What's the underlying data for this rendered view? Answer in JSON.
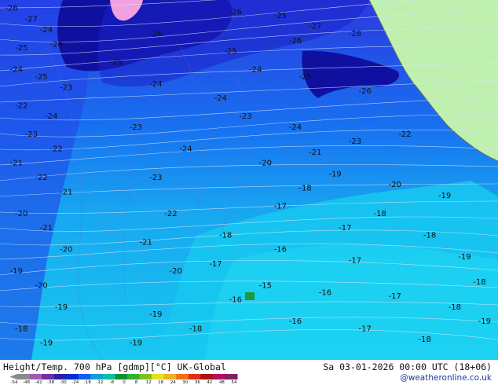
{
  "footer": {
    "title": "Height/Temp. 700 hPa [gdmp][°C] UK-Global",
    "datetime": "Sa 03-01-2026 00:00 UTC (18+06)",
    "credit": "@weatheronline.co.uk"
  },
  "legend": {
    "ticks": [
      "-54",
      "-48",
      "-42",
      "-38",
      "-30",
      "-24",
      "-18",
      "-12",
      "-8",
      "0",
      "8",
      "12",
      "18",
      "24",
      "30",
      "36",
      "42",
      "48",
      "54"
    ],
    "colors": [
      "#8a8a8a",
      "#a05ab4",
      "#7030a0",
      "#3020a0",
      "#0030d0",
      "#1060f0",
      "#10a0d8",
      "#10c0a0",
      "#109030",
      "#30b030",
      "#80c020",
      "#e0e020",
      "#f0b020",
      "#f07010",
      "#e03010",
      "#b01010",
      "#b01060",
      "#802060"
    ]
  },
  "map": {
    "land_color": "#bff0b0",
    "colors": {
      "ice_pink": "#f0a0e0",
      "deep_blue": "#1010a0",
      "mid_blue": "#2a3ae0",
      "bright_blue": "#1870f0",
      "cyan_blue": "#18a8f0",
      "cyan": "#18d0f0"
    },
    "contour_labels": [
      {
        "t": "-26",
        "xf": 0.01,
        "yf": 0.03
      },
      {
        "t": "-27",
        "xf": 0.05,
        "yf": 0.06
      },
      {
        "t": "-24",
        "xf": 0.08,
        "yf": 0.09
      },
      {
        "t": "-25",
        "xf": 0.03,
        "yf": 0.14
      },
      {
        "t": "-26",
        "xf": 0.1,
        "yf": 0.13
      },
      {
        "t": "-24",
        "xf": 0.02,
        "yf": 0.2
      },
      {
        "t": "-25",
        "xf": 0.07,
        "yf": 0.22
      },
      {
        "t": "-23",
        "xf": 0.12,
        "yf": 0.25
      },
      {
        "t": "-22",
        "xf": 0.03,
        "yf": 0.3
      },
      {
        "t": "-24",
        "xf": 0.09,
        "yf": 0.33
      },
      {
        "t": "-23",
        "xf": 0.05,
        "yf": 0.38
      },
      {
        "t": "-22",
        "xf": 0.1,
        "yf": 0.42
      },
      {
        "t": "-21",
        "xf": 0.02,
        "yf": 0.46
      },
      {
        "t": "-22",
        "xf": 0.07,
        "yf": 0.5
      },
      {
        "t": "-21",
        "xf": 0.12,
        "yf": 0.54
      },
      {
        "t": "-20",
        "xf": 0.03,
        "yf": 0.6
      },
      {
        "t": "-21",
        "xf": 0.08,
        "yf": 0.64
      },
      {
        "t": "-20",
        "xf": 0.12,
        "yf": 0.7
      },
      {
        "t": "-19",
        "xf": 0.02,
        "yf": 0.76
      },
      {
        "t": "-20",
        "xf": 0.07,
        "yf": 0.8
      },
      {
        "t": "-19",
        "xf": 0.11,
        "yf": 0.86
      },
      {
        "t": "-18",
        "xf": 0.03,
        "yf": 0.92
      },
      {
        "t": "-19",
        "xf": 0.08,
        "yf": 0.96
      },
      {
        "t": "-26",
        "xf": 0.46,
        "yf": 0.04
      },
      {
        "t": "-25",
        "xf": 0.55,
        "yf": 0.05
      },
      {
        "t": "-27",
        "xf": 0.62,
        "yf": 0.08
      },
      {
        "t": "-28",
        "xf": 0.7,
        "yf": 0.1
      },
      {
        "t": "-26",
        "xf": 0.58,
        "yf": 0.12
      },
      {
        "t": "-25",
        "xf": 0.45,
        "yf": 0.15
      },
      {
        "t": "-24",
        "xf": 0.5,
        "yf": 0.2
      },
      {
        "t": "-25",
        "xf": 0.6,
        "yf": 0.22
      },
      {
        "t": "-26",
        "xf": 0.72,
        "yf": 0.26
      },
      {
        "t": "-24",
        "xf": 0.43,
        "yf": 0.28
      },
      {
        "t": "-23",
        "xf": 0.48,
        "yf": 0.33
      },
      {
        "t": "-24",
        "xf": 0.58,
        "yf": 0.36
      },
      {
        "t": "-22",
        "xf": 0.8,
        "yf": 0.38
      },
      {
        "t": "-23",
        "xf": 0.7,
        "yf": 0.4
      },
      {
        "t": "-21",
        "xf": 0.62,
        "yf": 0.43
      },
      {
        "t": "-20",
        "xf": 0.52,
        "yf": 0.46
      },
      {
        "t": "-19",
        "xf": 0.66,
        "yf": 0.49
      },
      {
        "t": "-18",
        "xf": 0.6,
        "yf": 0.53
      },
      {
        "t": "-20",
        "xf": 0.78,
        "yf": 0.52
      },
      {
        "t": "-19",
        "xf": 0.88,
        "yf": 0.55
      },
      {
        "t": "-17",
        "xf": 0.55,
        "yf": 0.58
      },
      {
        "t": "-18",
        "xf": 0.75,
        "yf": 0.6
      },
      {
        "t": "-17",
        "xf": 0.68,
        "yf": 0.64
      },
      {
        "t": "-18",
        "xf": 0.85,
        "yf": 0.66
      },
      {
        "t": "-16",
        "xf": 0.55,
        "yf": 0.7
      },
      {
        "t": "-17",
        "xf": 0.7,
        "yf": 0.73
      },
      {
        "t": "-15",
        "xf": 0.52,
        "yf": 0.8
      },
      {
        "t": "-16",
        "xf": 0.64,
        "yf": 0.82
      },
      {
        "t": "-17",
        "xf": 0.78,
        "yf": 0.83
      },
      {
        "t": "-18",
        "xf": 0.9,
        "yf": 0.86
      },
      {
        "t": "-16",
        "xf": 0.58,
        "yf": 0.9
      },
      {
        "t": "-17",
        "xf": 0.72,
        "yf": 0.92
      },
      {
        "t": "-18",
        "xf": 0.84,
        "yf": 0.95
      },
      {
        "t": "-19",
        "xf": 0.3,
        "yf": 0.88
      },
      {
        "t": "-18",
        "xf": 0.38,
        "yf": 0.92
      },
      {
        "t": "-19",
        "xf": 0.26,
        "yf": 0.96
      },
      {
        "t": "-20",
        "xf": 0.34,
        "yf": 0.76
      },
      {
        "t": "-21",
        "xf": 0.28,
        "yf": 0.68
      },
      {
        "t": "-22",
        "xf": 0.33,
        "yf": 0.6
      },
      {
        "t": "-23",
        "xf": 0.3,
        "yf": 0.5
      },
      {
        "t": "-24",
        "xf": 0.36,
        "yf": 0.42
      },
      {
        "t": "-23",
        "xf": 0.26,
        "yf": 0.36
      },
      {
        "t": "-24",
        "xf": 0.3,
        "yf": 0.24
      },
      {
        "t": "-25",
        "xf": 0.22,
        "yf": 0.18
      },
      {
        "t": "-26",
        "xf": 0.3,
        "yf": 0.1
      },
      {
        "t": "-18",
        "xf": 0.44,
        "yf": 0.66
      },
      {
        "t": "-17",
        "xf": 0.42,
        "yf": 0.74
      },
      {
        "t": "-16",
        "xf": 0.46,
        "yf": 0.84
      },
      {
        "t": "-19",
        "xf": 0.92,
        "yf": 0.72
      },
      {
        "t": "-18",
        "xf": 0.95,
        "yf": 0.79
      },
      {
        "t": "-19",
        "xf": 0.96,
        "yf": 0.9
      }
    ]
  }
}
